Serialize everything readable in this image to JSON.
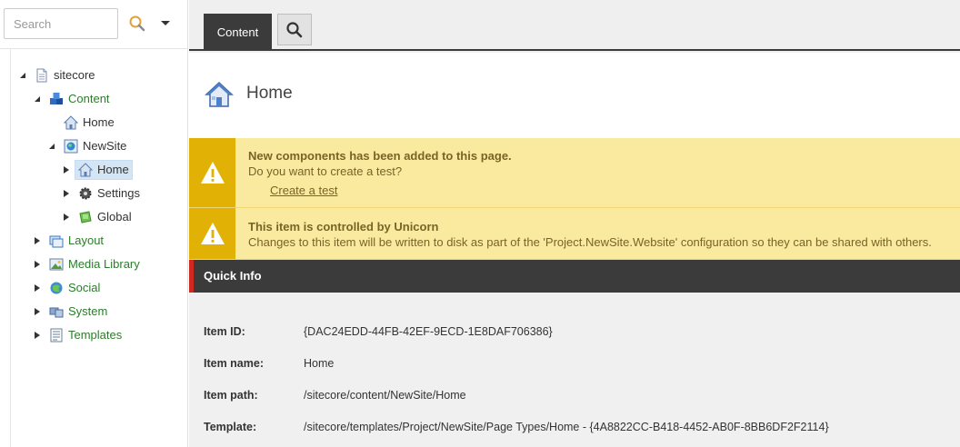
{
  "search": {
    "placeholder": "Search"
  },
  "tree": {
    "root": "sitecore",
    "content": "Content",
    "home_top": "Home",
    "newsite": "NewSite",
    "home_selected": "Home",
    "settings": "Settings",
    "global": "Global",
    "layout": "Layout",
    "media_library": "Media Library",
    "social": "Social",
    "system": "System",
    "templates": "Templates"
  },
  "tabs": {
    "content": "Content"
  },
  "header": {
    "title": "Home"
  },
  "notifications": {
    "first_title": "New components has been added to this page.",
    "first_text": "Do you want to create a test?",
    "first_link": "Create a test",
    "second_title": "This item is controlled by Unicorn",
    "second_text": "Changes to this item will be written to disk as part of the 'Project.NewSite.Website' configuration so they can be shared with others."
  },
  "quick_info": {
    "title": "Quick Info",
    "rows": [
      {
        "label": "Item ID:",
        "value": "{DAC24EDD-44FB-42EF-9ECD-1E8DAF706386}"
      },
      {
        "label": "Item name:",
        "value": "Home"
      },
      {
        "label": "Item path:",
        "value": "/sitecore/content/NewSite/Home"
      },
      {
        "label": "Template:",
        "value": "/sitecore/templates/Project/NewSite/Page Types/Home - {4A8822CC-B418-4452-AB0F-8BB6DF2F2114}"
      }
    ]
  },
  "colors": {
    "accent_dark": "#3b3b3b",
    "warning_bg": "#faeaa0",
    "warning_icon_bg": "#e1b205",
    "quick_info_marker": "#d0281f",
    "tree_green": "#2c7c2c",
    "selection": "#d4e6f5"
  },
  "icons": [
    "search-icon",
    "chevron-down-icon",
    "document-icon",
    "cubes-icon",
    "house-icon",
    "globe-site-icon",
    "gear-icon",
    "green-folder-icon",
    "layout-icon",
    "media-icon",
    "social-icon",
    "system-icon",
    "templates-icon",
    "warning-icon"
  ]
}
